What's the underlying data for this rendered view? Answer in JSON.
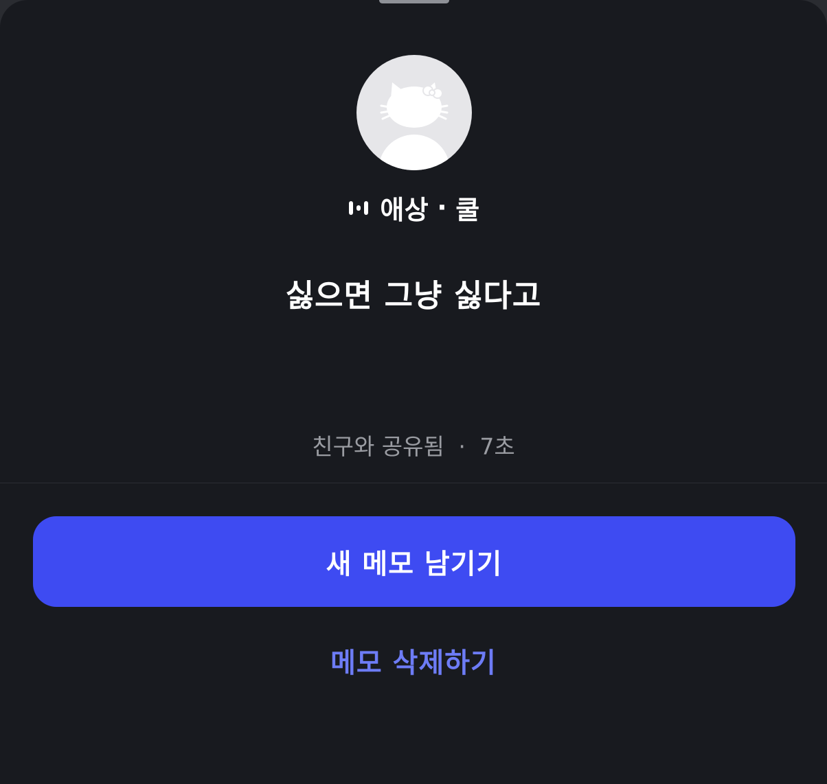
{
  "memo_sheet": {
    "avatar_icon": "hello-kitty-silhouette-icon",
    "music_icon": "music-equalizer-icon",
    "song_title": "애상",
    "separator": "·",
    "artist": "쿨",
    "memo_text": "싫으면 그냥 싫다고",
    "shared_status": "친구와 공유됨",
    "elapsed_time": "7초",
    "new_memo_label": "새 메모 남기기",
    "delete_memo_label": "메모 삭제하기"
  },
  "colors": {
    "background": "#181a1f",
    "primary_button": "#3e4bf2",
    "delete_text": "#6d7cf6",
    "meta_text": "#9a9ca2",
    "avatar_bg": "#e6e6e9"
  }
}
